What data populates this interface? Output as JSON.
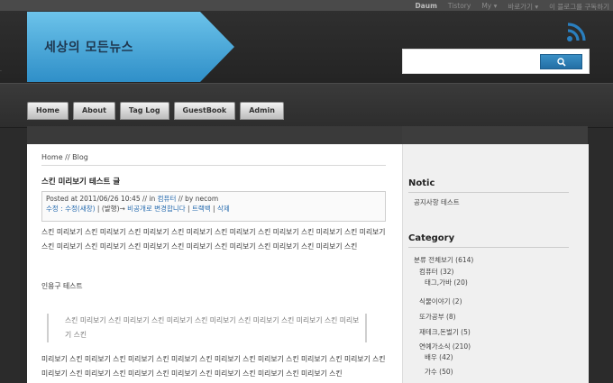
{
  "topnav": {
    "items": [
      {
        "label": "Daum"
      },
      {
        "label": "Tistory"
      },
      {
        "label": "My ▾"
      },
      {
        "label": "바로가기 ▾"
      },
      {
        "label": "이 블로그를 구독하기"
      }
    ]
  },
  "header": {
    "site_title": "세상의 모든뉴스",
    "side_mark": "·"
  },
  "search": {
    "placeholder": ""
  },
  "tabs": [
    {
      "label": "Home"
    },
    {
      "label": "About"
    },
    {
      "label": "Tag Log"
    },
    {
      "label": "GuestBook"
    },
    {
      "label": "Admin"
    }
  ],
  "post": {
    "breadcrumb": "Home // Blog",
    "title": "스킨 미리보기 테스트 글",
    "meta_posted": "Posted at 2011/06/26 10:45 // in ",
    "meta_category": "컴퓨터",
    "meta_by": " // by necom",
    "meta_line2_a": "수정 : 수정(새창)",
    "meta_line2_b": " | (발행)→",
    "meta_line2_c": " 비공개로 변경합니다",
    "meta_line2_d": " | ",
    "meta_line2_e": "트랙백",
    "meta_line2_f": " | ",
    "meta_line2_g": "삭제",
    "para1": "스킨 미리보기 스킨 미리보기 스킨 미리보기 스킨 미리보기 스킨 미리보기 스킨 미리보기 스킨 미리보기 스킨 미리보기 스킨 미리보기 스킨 미리보기 스킨 미리보기 스킨 미리보기 스킨 미리보기 스킨 미리보기 스킨 미리보기 스킨",
    "para2": "인용구 테스트",
    "quote": "스킨 미리보기 스킨 미리보기 스킨 미리보기 스킨 미리보기 스킨 미리보기 스킨 미리보기 스킨 미리보기 스킨",
    "para3": "미리보기 스킨 미리보기 스킨 미리보기 스킨 미리보기 스킨 미리보기 스킨 미리보기 스킨 미리보기 스킨 미리보기 스킨 미리보기 스킨 미리보기 스킨 미리보기 스킨 미리보기 스킨 미리보기 스킨 미리보기 스킨 미리보기 스킨"
  },
  "sidebar": {
    "notice_title": "Notic",
    "notice_item": "공지사항 테스트",
    "category_title": "Category",
    "categories": [
      {
        "label": "분류 전체보기 (614)"
      },
      {
        "label": "컴퓨터 (32)"
      },
      {
        "label": "태그,가바 (20)"
      },
      {
        "label": "식물이야기 (2)"
      },
      {
        "label": "또가공부 (8)"
      },
      {
        "label": "재테크,돈벌기 (5)"
      },
      {
        "label": "연예가소식 (210)"
      },
      {
        "label": "배우 (42)"
      },
      {
        "label": "가수 (50)"
      }
    ]
  },
  "colors": {
    "accent": "#3a8fc5",
    "link": "#2a6db0",
    "rss": "#2a7fbf"
  }
}
